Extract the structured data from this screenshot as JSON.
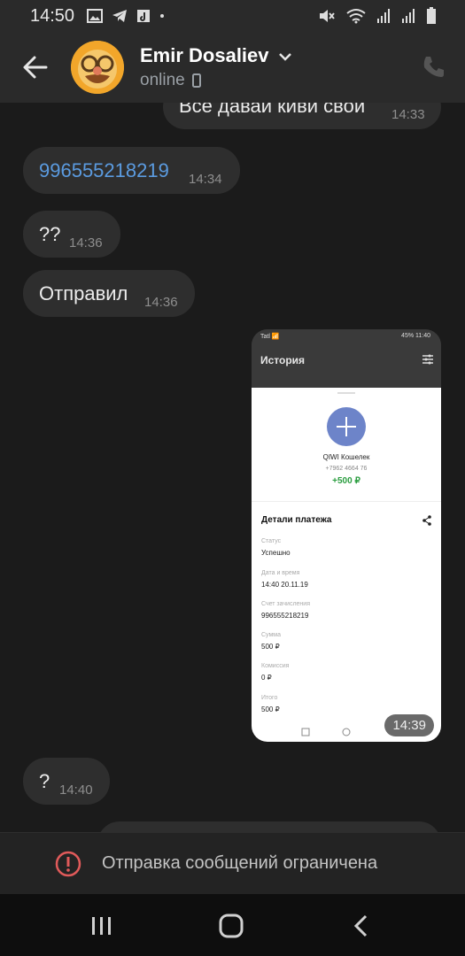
{
  "status_bar": {
    "time": "14:50",
    "notification_icons": [
      "gallery-icon",
      "telegram-icon",
      "music-icon"
    ],
    "system_icons": [
      "mute-icon",
      "wifi-icon",
      "signal-icon",
      "signal-icon",
      "battery-icon"
    ]
  },
  "header": {
    "contact_name": "Emir Dosaliev",
    "presence": "online"
  },
  "messages": [
    {
      "direction": "out",
      "text": "Все давай киви свой",
      "time": "14:33"
    },
    {
      "direction": "in",
      "text": "996555218219",
      "time": "14:34",
      "is_link": true
    },
    {
      "direction": "in",
      "text": "??",
      "time": "14:36"
    },
    {
      "direction": "in",
      "text": "Отправил",
      "time": "14:36"
    },
    {
      "direction": "out",
      "type": "image",
      "time": "14:39"
    },
    {
      "direction": "in",
      "text": "?",
      "time": "14:40"
    }
  ],
  "screenshot": {
    "status_left": "Tatl 📶",
    "status_right": "45% 11:40",
    "title": "История",
    "wallet": "QIWI Кошелек",
    "phone": "+7962 4664 76",
    "amount": "+500 ₽",
    "details_title": "Детали платежа",
    "fields": [
      {
        "label": "Статус",
        "value": "Успешно"
      },
      {
        "label": "Дата и время",
        "value": "14:40 20.11.19"
      },
      {
        "label": "Счет зачисления",
        "value": "996555218219"
      },
      {
        "label": "Сумма",
        "value": "500 ₽"
      },
      {
        "label": "Комиссия",
        "value": "0 ₽"
      },
      {
        "label": "Итого",
        "value": "500 ₽"
      }
    ]
  },
  "restriction": {
    "text": "Отправка сообщений ограничена"
  },
  "colors": {
    "background": "#1b1b1b",
    "bubble": "#2e2e2e",
    "link": "#5b9be0",
    "warning": "#e05a5a"
  }
}
